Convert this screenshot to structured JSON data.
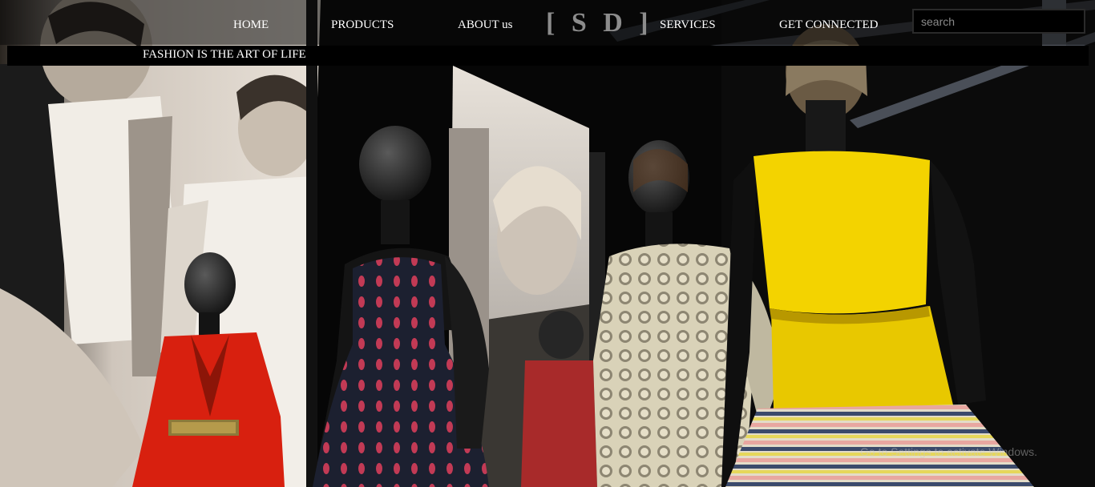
{
  "nav": {
    "home": "HOME",
    "products": "PRODUCTS",
    "about": "ABOUT us",
    "logo": "[ S D ]",
    "services": "SERVICES",
    "connect": "GET CONNECTED"
  },
  "search": {
    "placeholder": "search",
    "value": ""
  },
  "tagline": "FASHION IS THE ART OF LIFE",
  "hero": {
    "image": "mannequins-fashion-exhibition-photo"
  },
  "os_watermark": "Go to Settings to activate Windows.",
  "colors": {
    "background": "#000000",
    "nav_text": "#ffffff",
    "logo": "#8c8c8c",
    "red_jacket": "#d8200f",
    "yellow_top": "#f3d300"
  }
}
